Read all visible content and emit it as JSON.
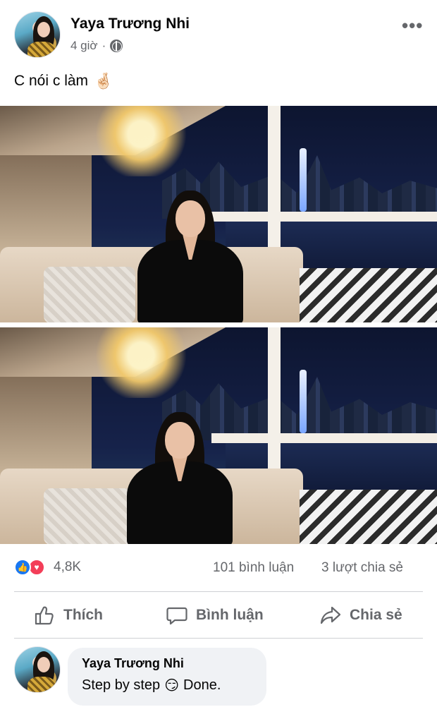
{
  "post": {
    "author_name": "Yaya Trương Nhi",
    "time": "4 giờ",
    "separator": "·",
    "privacy_icon": "globe-icon",
    "more_label": "•••",
    "caption_text": "C nói c làm",
    "caption_emoji": "🤞🏻"
  },
  "photos": [
    {
      "name": "post-photo-1",
      "scene": "woman in black dress on terrace sofa, night city river view"
    },
    {
      "name": "post-photo-2",
      "scene": "woman in black dress on terrace sofa with wine glass, night city river view"
    }
  ],
  "stats": {
    "reactions_count": "4,8K",
    "reaction_icons": [
      "like-icon",
      "love-icon"
    ],
    "comments": "101 bình luận",
    "shares": "3 lượt chia sẻ"
  },
  "actions": {
    "like_label": "Thích",
    "comment_label": "Bình luận",
    "share_label": "Chia sẻ"
  },
  "comment": {
    "author_name": "Yaya Trương Nhi",
    "text": "Step by step",
    "emoji": "😏",
    "text_after": "Done."
  },
  "colors": {
    "text_primary": "#050505",
    "text_secondary": "#65676b",
    "like_blue": "#1877f2",
    "love_red": "#f33e58",
    "bubble_bg": "#f0f2f5",
    "divider": "#ced0d4"
  }
}
